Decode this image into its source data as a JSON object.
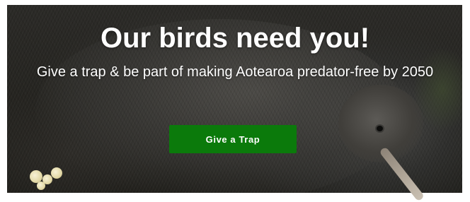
{
  "hero": {
    "headline": "Our birds need you!",
    "subheadline": "Give a trap & be part of making Aotearoa predator-free by 2050",
    "cta_label": "Give a Trap",
    "cta_color": "#0b7a0b",
    "text_color": "#ffffff"
  }
}
